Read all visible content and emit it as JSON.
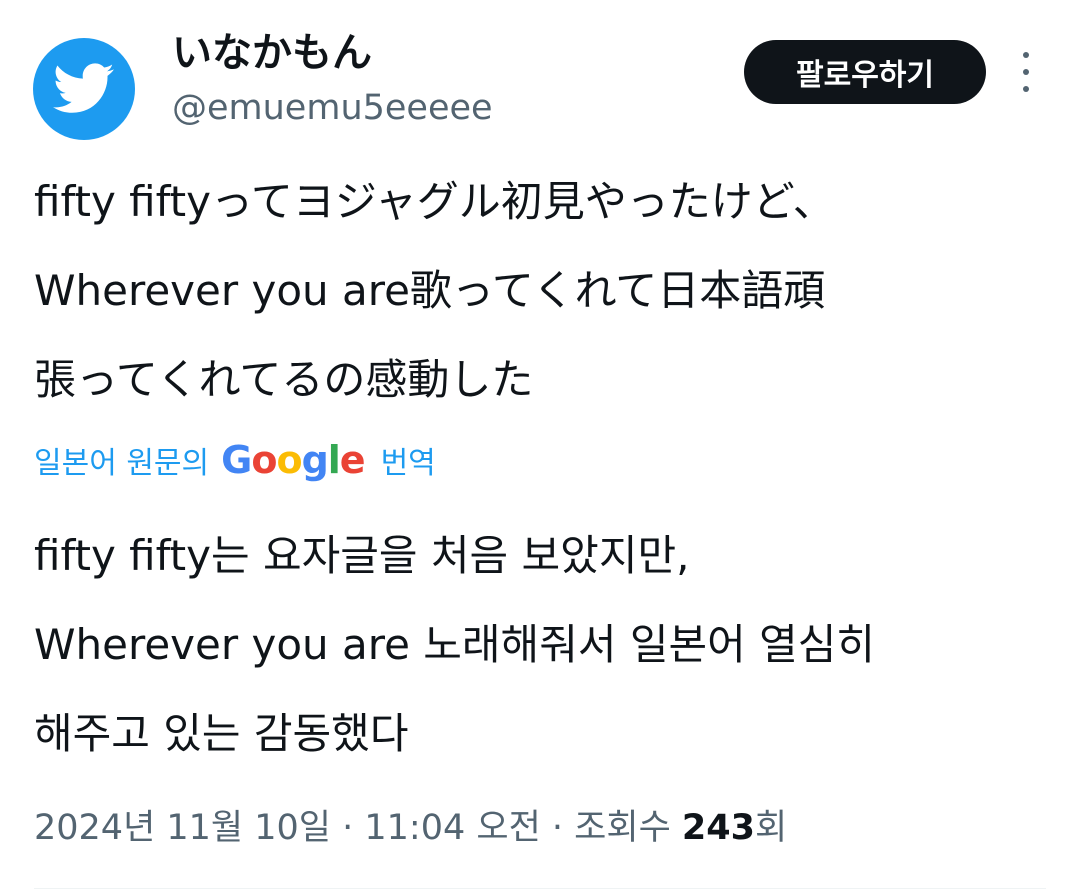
{
  "user": {
    "display_name": "いなかもん",
    "handle": "@emuemu5eeeee",
    "avatar_icon": "twitter-bird-icon"
  },
  "follow_button": {
    "label": "팔로우하기"
  },
  "more_button": {
    "icon": "more-vertical-icon"
  },
  "tweet": {
    "original_lines": [
      "fifty fiftyってヨジャグル初見やったけど、",
      "Wherever you are歌ってくれて日本語頑",
      "張ってくれてるの感動した"
    ],
    "translation_label_pre": "일본어 원문의",
    "translation_provider": "Google",
    "translation_label_post": "번역",
    "translated_lines": [
      "fifty fifty는 요자글을 처음 보았지만,",
      "Wherever you are 노래해줘서 일본어 열심히",
      "해주고 있는 감동했다"
    ]
  },
  "meta": {
    "date": "2024년 11월 10일",
    "sep1": " · ",
    "time": "11:04 오전",
    "sep2": " · ",
    "views_label_pre": "조회수 ",
    "views_count": "243",
    "views_label_post": "회"
  },
  "colors": {
    "avatar_bg": "#1d9bf0",
    "link": "#1d9bf0",
    "button_bg": "#0f1419",
    "secondary_text": "#536471"
  }
}
